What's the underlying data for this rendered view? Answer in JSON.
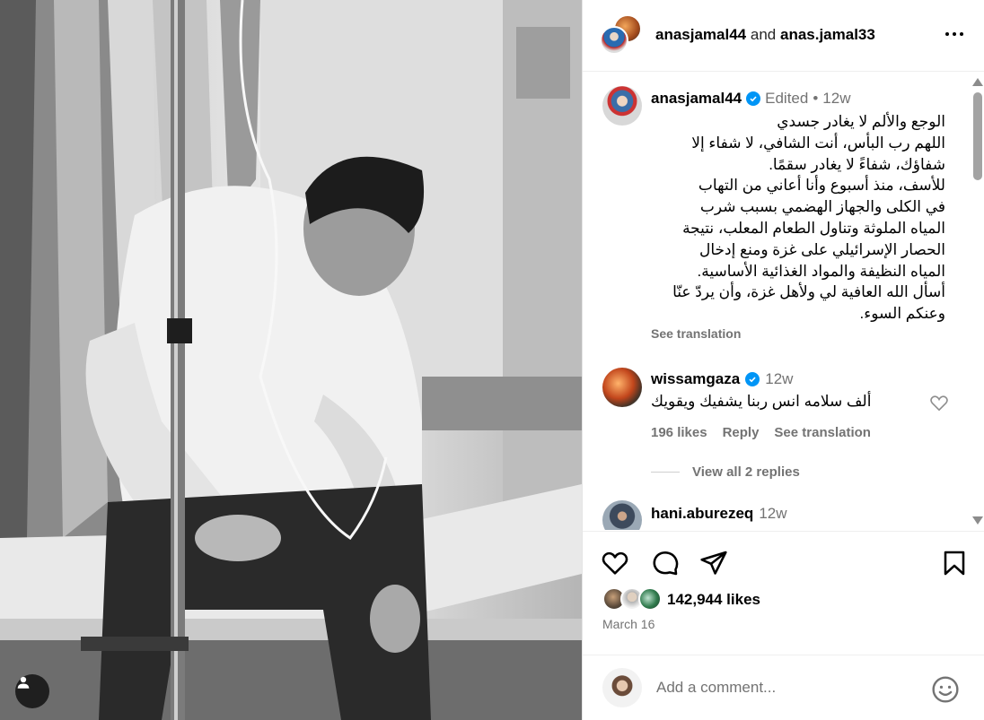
{
  "header": {
    "user1": "anasjamal44",
    "and": "and",
    "user2": "anas.jamal33"
  },
  "post": {
    "username": "anasjamal44",
    "edited": "Edited",
    "dot": "•",
    "time": "12w",
    "caption_lines": [
      "الوجع والألم لا يغادر جسدي",
      "اللهم رب البأس، أنت الشافي، لا شفاء إلا",
      "شفاؤك، شفاءً لا يغادر سقمًا.",
      "للأسف، منذ أسبوع وأنا أعاني من التهاب",
      "في الكلى والجهاز الهضمي بسبب شرب",
      "المياه الملوثة وتناول الطعام المعلب، نتيجة",
      "الحصار الإسرائيلي على غزة ومنع إدخال",
      "المياه النظيفة والمواد الغذائية الأساسية.",
      "أسأل الله العافية لي ولأهل غزة، وأن يردّ عنّا",
      "وعنكم السوء."
    ],
    "see_translation": "See translation"
  },
  "comments": [
    {
      "username": "wissamgaza",
      "time": "12w",
      "text": "ألف سلامه انس ربنا يشفيك ويقويك",
      "likes": "196 likes",
      "reply": "Reply",
      "see_translation": "See translation",
      "view_replies": "View all 2 replies"
    },
    {
      "username": "hani.aburezeq",
      "time": "12w"
    }
  ],
  "footer": {
    "likes": "142,944 likes",
    "date": "March 16",
    "comment_placeholder": "Add a comment..."
  },
  "colors": {
    "verified": "#0095f6",
    "muted": "#737373"
  },
  "icons": {
    "more": "more-horizontal-icon",
    "verified": "verified-badge-icon",
    "heart": "heart-icon",
    "comment": "comment-icon",
    "share": "share-icon",
    "save": "bookmark-icon",
    "emoji": "emoji-icon",
    "user": "user-icon"
  }
}
